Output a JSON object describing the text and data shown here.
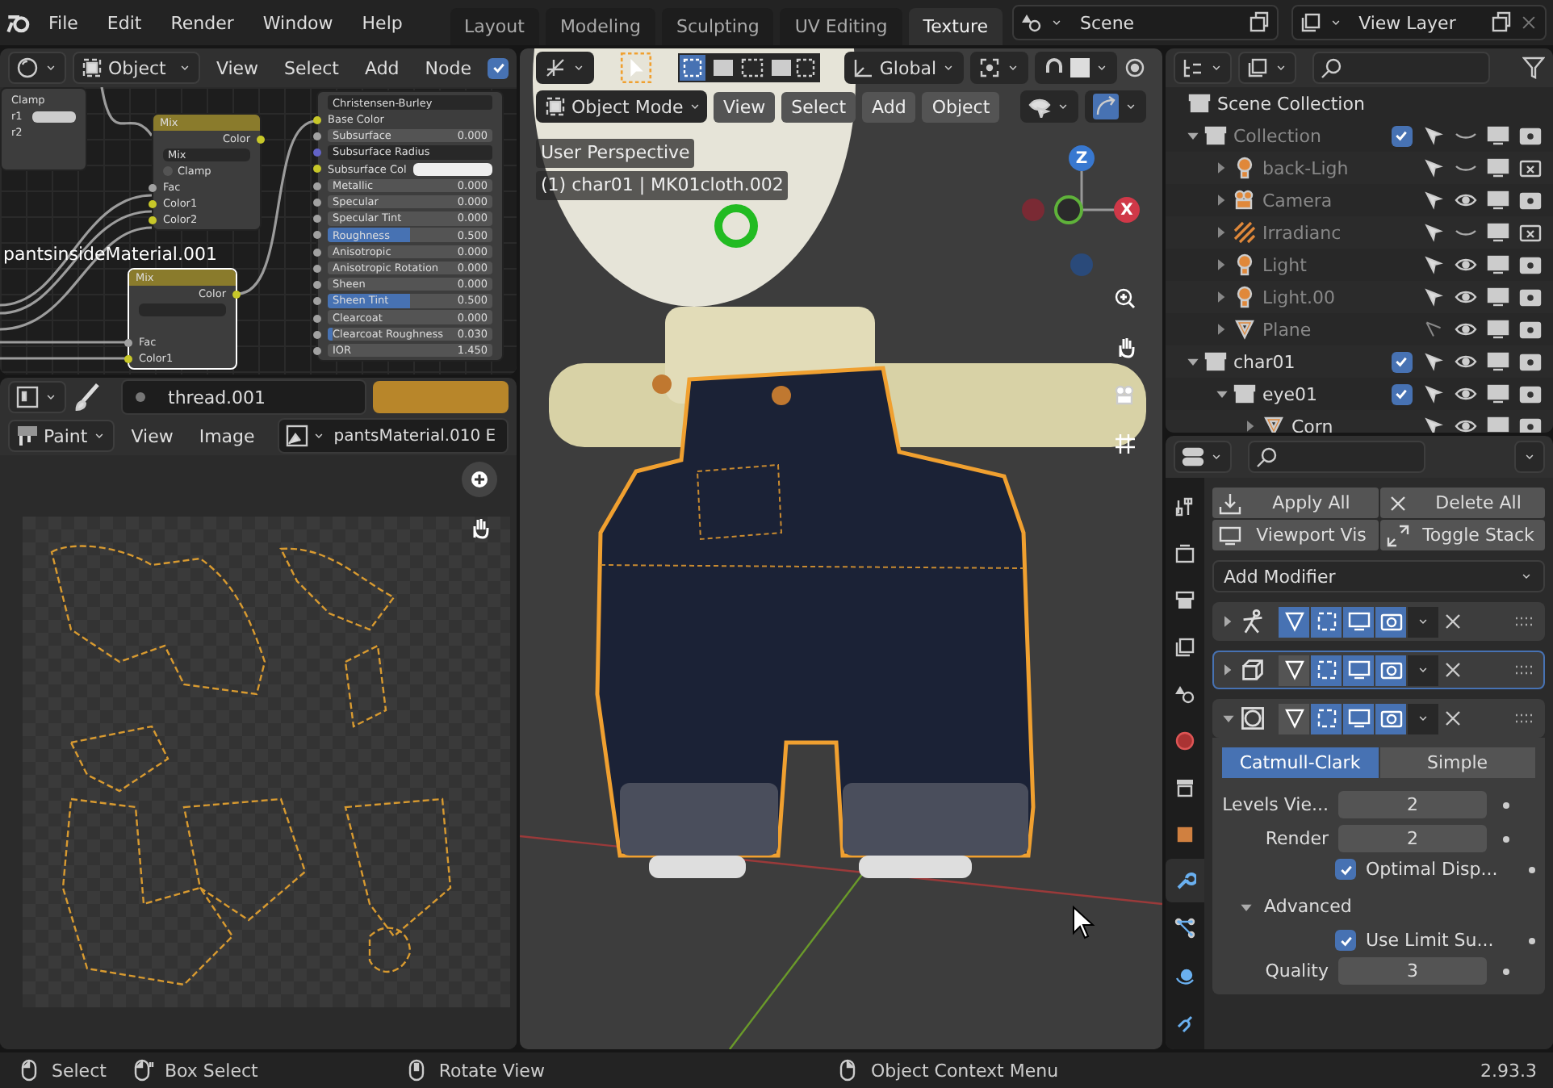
{
  "topbar": {
    "menus": [
      "File",
      "Edit",
      "Render",
      "Window",
      "Help"
    ],
    "workspaces": [
      {
        "label": "Layout",
        "selected": false
      },
      {
        "label": "Modeling",
        "selected": false
      },
      {
        "label": "Sculpting",
        "selected": false
      },
      {
        "label": "UV Editing",
        "selected": false
      },
      {
        "label": "Texture",
        "selected": true
      }
    ],
    "scene": "Scene",
    "view_layer": "View Layer"
  },
  "node_editor": {
    "object_type": "Object",
    "menus": [
      "View",
      "Select",
      "Add",
      "Node"
    ],
    "use_nodes": true,
    "partial_node": {
      "rows": [
        "Clamp",
        "r1",
        "r2"
      ]
    },
    "mix_nodes": [
      {
        "title": "Mix",
        "output": "Color",
        "blend": "Mix",
        "clamp": {
          "label": "Clamp",
          "checked": false
        },
        "inputs": [
          "Fac",
          "Color1",
          "Color2"
        ],
        "selected": false
      },
      {
        "title": "Mix",
        "output": "Color",
        "inputs": [
          "Fac",
          "Color1"
        ],
        "selected": true
      }
    ],
    "principled": {
      "method": "Christensen-Burley",
      "inputs": [
        {
          "label": "Base Color",
          "kind": "socket"
        },
        {
          "label": "Subsurface",
          "kind": "slider",
          "value": "0.000",
          "level": 0
        },
        {
          "label": "Subsurface Radius",
          "kind": "vector"
        },
        {
          "label": "Subsurface Col",
          "kind": "color"
        },
        {
          "label": "Metallic",
          "kind": "slider",
          "value": "0.000",
          "level": 0
        },
        {
          "label": "Specular",
          "kind": "slider",
          "value": "0.000",
          "level": 0
        },
        {
          "label": "Specular Tint",
          "kind": "slider",
          "value": "0.000",
          "level": 0
        },
        {
          "label": "Roughness",
          "kind": "slider",
          "value": "0.500",
          "level": 0.5
        },
        {
          "label": "Anisotropic",
          "kind": "slider",
          "value": "0.000",
          "level": 0
        },
        {
          "label": "Anisotropic Rotation",
          "kind": "slider",
          "value": "0.000",
          "level": 0
        },
        {
          "label": "Sheen",
          "kind": "slider",
          "value": "0.000",
          "level": 0
        },
        {
          "label": "Sheen Tint",
          "kind": "slider",
          "value": "0.500",
          "level": 0.5
        },
        {
          "label": "Clearcoat",
          "kind": "slider",
          "value": "0.000",
          "level": 0
        },
        {
          "label": "Clearcoat Roughness",
          "kind": "slider",
          "value": "0.030",
          "level": 0.03
        },
        {
          "label": "IOR",
          "kind": "number",
          "value": "1.450"
        }
      ]
    },
    "frame_label": "pantsinsideMaterial.001"
  },
  "image_editor": {
    "brush": "thread.001",
    "mode": "Paint",
    "menus": [
      "View",
      "Image"
    ],
    "image": "pantsMaterial.010 E"
  },
  "viewport": {
    "orientation": "Global",
    "mode": "Object Mode",
    "menus": [
      "View",
      "Select",
      "Add",
      "Object"
    ],
    "perspective": "User Perspective",
    "active_object": "(1) char01 | MK01cloth.002",
    "gizmo_labels": [
      "Z",
      "X"
    ]
  },
  "outliner": {
    "root": "Scene Collection",
    "tree": [
      {
        "name": "Collection",
        "kind": "collection",
        "expanded": true,
        "checked": true,
        "selectable": true,
        "visible": false,
        "render": true,
        "children": [
          {
            "name": "back-Ligh",
            "kind": "light",
            "expanded": false,
            "selectable": true,
            "visible": false,
            "render": false
          },
          {
            "name": "Camera",
            "kind": "camera",
            "expanded": false,
            "selectable": true,
            "visible": true,
            "render": true
          },
          {
            "name": "Irradianc",
            "kind": "probe",
            "expanded": false,
            "selectable": true,
            "visible": false,
            "render": false
          },
          {
            "name": "Light",
            "kind": "light",
            "expanded": false,
            "selectable": true,
            "visible": true,
            "render": true
          },
          {
            "name": "Light.00",
            "kind": "light",
            "expanded": false,
            "selectable": true,
            "visible": true,
            "render": true
          },
          {
            "name": "Plane",
            "kind": "mesh",
            "expanded": false,
            "selectable": false,
            "visible": true,
            "render": true
          }
        ]
      },
      {
        "name": "char01",
        "kind": "collection",
        "expanded": true,
        "checked": true,
        "selectable": true,
        "visible": true,
        "render": true,
        "children": [
          {
            "name": "eye01",
            "kind": "collection",
            "expanded": true,
            "checked": true,
            "selectable": true,
            "visible": true,
            "render": true,
            "children": [
              {
                "name": "Corn",
                "kind": "mesh",
                "expanded": false,
                "selectable": true,
                "visible": true,
                "render": true
              }
            ]
          }
        ]
      }
    ]
  },
  "properties": {
    "tabs": [
      {
        "kind": "tool",
        "selected": false
      },
      {
        "kind": "render",
        "selected": false
      },
      {
        "kind": "output",
        "selected": false
      },
      {
        "kind": "view_layer",
        "selected": false
      },
      {
        "kind": "scene",
        "selected": false
      },
      {
        "kind": "world",
        "selected": false
      },
      {
        "kind": "collection",
        "selected": false
      },
      {
        "kind": "object",
        "selected": false
      },
      {
        "kind": "modifiers",
        "selected": true
      },
      {
        "kind": "particles",
        "selected": false
      },
      {
        "kind": "physics",
        "selected": false
      },
      {
        "kind": "constraints",
        "selected": false
      }
    ],
    "buttons": [
      {
        "kind": "apply",
        "label": "Apply All"
      },
      {
        "kind": "delete",
        "label": "Delete All"
      },
      {
        "kind": "viewport",
        "label": "Viewport Vis"
      },
      {
        "kind": "stack",
        "label": "Toggle Stack"
      }
    ],
    "add_modifier": "Add Modifier",
    "modifiers": [
      {
        "kind": "armature",
        "expanded": false,
        "active": false,
        "edit_mode": true
      },
      {
        "kind": "lattice",
        "expanded": false,
        "active": true,
        "edit_mode": false
      },
      {
        "kind": "subsurf",
        "expanded": true,
        "active": false,
        "edit_mode": false
      }
    ],
    "subdivision": {
      "types": [
        {
          "label": "Catmull-Clark",
          "selected": true
        },
        {
          "label": "Simple",
          "selected": false
        }
      ],
      "fields": [
        {
          "label": "Levels Vie...",
          "value": "2"
        },
        {
          "label": "Render",
          "value": "2"
        }
      ],
      "optimal_display": {
        "label": "Optimal Disp...",
        "checked": true
      },
      "advanced": {
        "label": "Advanced",
        "expanded": true,
        "use_limit": {
          "label": "Use Limit Su...",
          "checked": true
        },
        "quality": {
          "label": "Quality",
          "value": "3"
        }
      }
    }
  },
  "status_bar": {
    "hints": [
      {
        "kind": "left",
        "label": "Select"
      },
      {
        "kind": "drag",
        "label": "Box Select"
      },
      {
        "kind": "middle",
        "label": "Rotate View"
      },
      {
        "kind": "right",
        "label": "Object Context Menu"
      }
    ],
    "version": "2.93.3"
  }
}
